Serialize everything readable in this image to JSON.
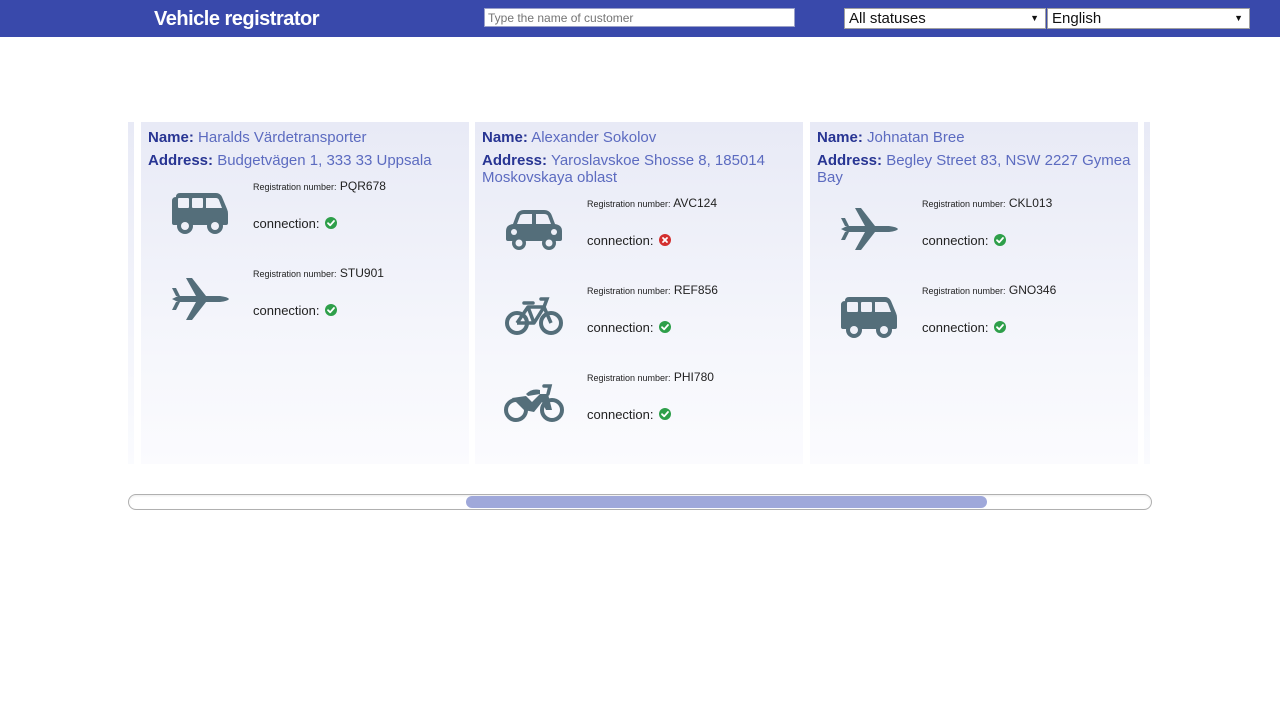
{
  "header": {
    "title": "Vehicle registrator",
    "search_placeholder": "Type the name of customer",
    "search_value": "",
    "status_filter": "All statuses",
    "language": "English",
    "colors": {
      "background": "#3949ab"
    }
  },
  "customers": [
    {
      "name_label": "Name:",
      "name": "Haralds Värdetransporter",
      "address_label": "Address:",
      "address": "Budgetvägen 1, 333 33 Uppsala",
      "vehicles": [
        {
          "type": "van-icon",
          "reg_label": "Registration number:",
          "reg": "PQR678",
          "conn_label": "connection:",
          "status": "connected"
        },
        {
          "type": "jet-icon",
          "reg_label": "Registration number:",
          "reg": "STU901",
          "conn_label": "connection:",
          "status": "connected"
        }
      ]
    },
    {
      "name_label": "Name:",
      "name": "Alexander Sokolov",
      "address_label": "Address:",
      "address": "Yaroslavskoe Shosse 8, 185014 Moskovskaya oblast",
      "vehicles": [
        {
          "type": "car-icon",
          "reg_label": "Registration number:",
          "reg": "AVC124",
          "conn_label": "connection:",
          "status": "disconnected"
        },
        {
          "type": "bicycle-icon",
          "reg_label": "Registration number:",
          "reg": "REF856",
          "conn_label": "connection:",
          "status": "connected"
        },
        {
          "type": "motorcycle-icon",
          "reg_label": "Registration number:",
          "reg": "PHI780",
          "conn_label": "connection:",
          "status": "connected"
        }
      ]
    },
    {
      "name_label": "Name:",
      "name": "Johnatan Bree",
      "address_label": "Address:",
      "address": "Begley Street 83, NSW 2227 Gymea Bay",
      "vehicles": [
        {
          "type": "jet-icon",
          "reg_label": "Registration number:",
          "reg": "CKL013",
          "conn_label": "connection:",
          "status": "connected"
        },
        {
          "type": "van-icon",
          "reg_label": "Registration number:",
          "reg": "GNO346",
          "conn_label": "connection:",
          "status": "connected"
        }
      ]
    }
  ],
  "scrollbar": {
    "position_fraction": 0.33,
    "visible_fraction": 0.51
  },
  "colors": {
    "icon": "#546e7a",
    "ok": "#2e9f4a",
    "error": "#d32f2f",
    "accent": "#5c6bc0",
    "label": "#283593"
  }
}
